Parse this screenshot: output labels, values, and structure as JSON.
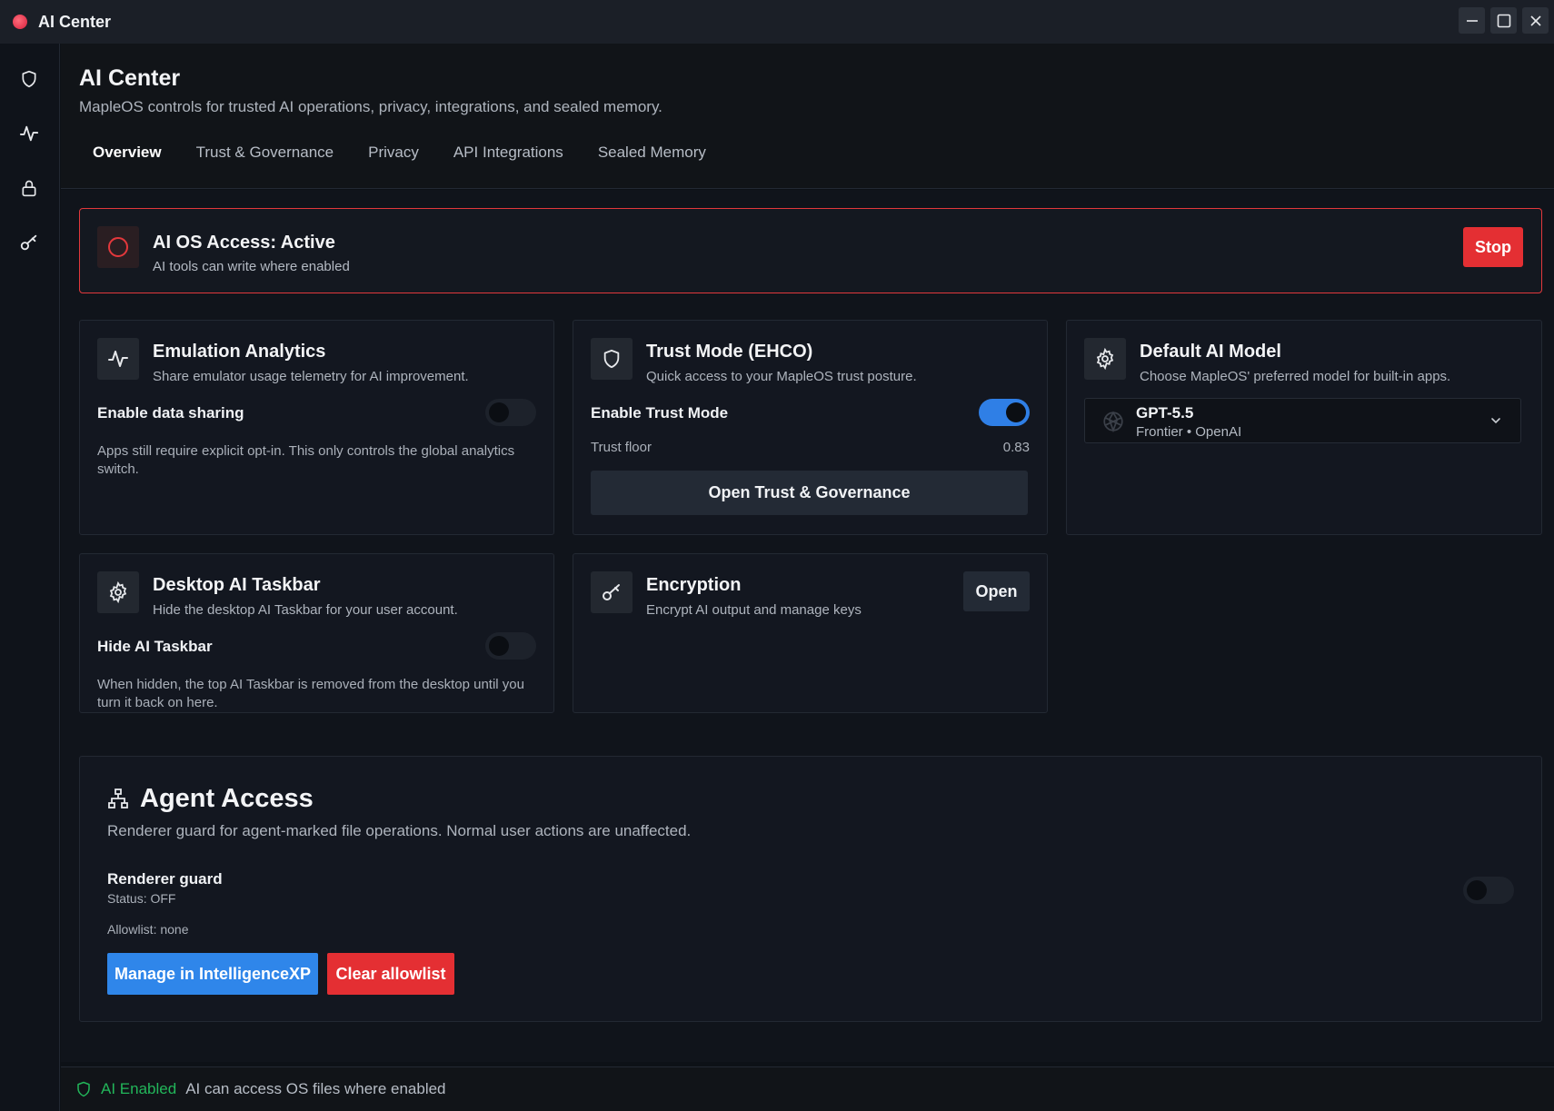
{
  "window": {
    "title": "AI Center",
    "controls": [
      "minimize",
      "maximize",
      "close"
    ]
  },
  "sidebar": {
    "items": [
      {
        "name": "shield-icon"
      },
      {
        "name": "activity-icon"
      },
      {
        "name": "lock-icon"
      },
      {
        "name": "key-icon"
      }
    ]
  },
  "header": {
    "title": "AI Center",
    "subtitle": "MapleOS controls for trusted AI operations, privacy, integrations, and sealed memory.",
    "tabs": [
      {
        "label": "Overview",
        "active": true
      },
      {
        "label": "Trust & Governance",
        "active": false
      },
      {
        "label": "Privacy",
        "active": false
      },
      {
        "label": "API Integrations",
        "active": false
      },
      {
        "label": "Sealed Memory",
        "active": false
      }
    ]
  },
  "banner": {
    "title": "AI OS Access: Active",
    "subtitle": "AI tools can write where enabled",
    "stop_label": "Stop",
    "accent": "#e2383c"
  },
  "cards": {
    "emulation": {
      "title": "Emulation Analytics",
      "subtitle": "Share emulator usage telemetry for AI improvement.",
      "toggle_label": "Enable data sharing",
      "toggle_on": false,
      "note": "Apps still require explicit opt-in. This only controls the global analytics switch."
    },
    "trust": {
      "title": "Trust Mode (EHCO)",
      "subtitle": "Quick access to your MapleOS trust posture.",
      "toggle_label": "Enable Trust Mode",
      "toggle_on": true,
      "floor_label": "Trust floor",
      "floor_value": "0.83",
      "button_label": "Open Trust & Governance"
    },
    "model": {
      "title": "Default AI Model",
      "subtitle": "Choose MapleOS' preferred model for built-in apps.",
      "selected_name": "GPT-5.5",
      "selected_meta": "Frontier • OpenAI"
    },
    "taskbar": {
      "title": "Desktop AI Taskbar",
      "subtitle": "Hide the desktop AI Taskbar for your user account.",
      "toggle_label": "Hide AI Taskbar",
      "toggle_on": false,
      "note": "When hidden, the top AI Taskbar is removed from the desktop until you turn it back on here."
    },
    "encryption": {
      "title": "Encryption",
      "subtitle": "Encrypt AI output and manage keys",
      "button_label": "Open"
    }
  },
  "agent": {
    "title": "Agent Access",
    "subtitle": "Renderer guard for agent-marked file operations. Normal user actions are unaffected.",
    "guard_label": "Renderer guard",
    "guard_status": "Status: OFF",
    "guard_on": false,
    "allowlist": "Allowlist: none",
    "manage_label": "Manage in IntelligenceXP",
    "clear_label": "Clear allowlist"
  },
  "status": {
    "label": "AI Enabled",
    "text": "AI can access OS files where enabled",
    "color": "#22b65a"
  },
  "colors": {
    "accent_blue": "#2f86ea",
    "danger_red": "#e42f33",
    "background": "#10141b"
  }
}
